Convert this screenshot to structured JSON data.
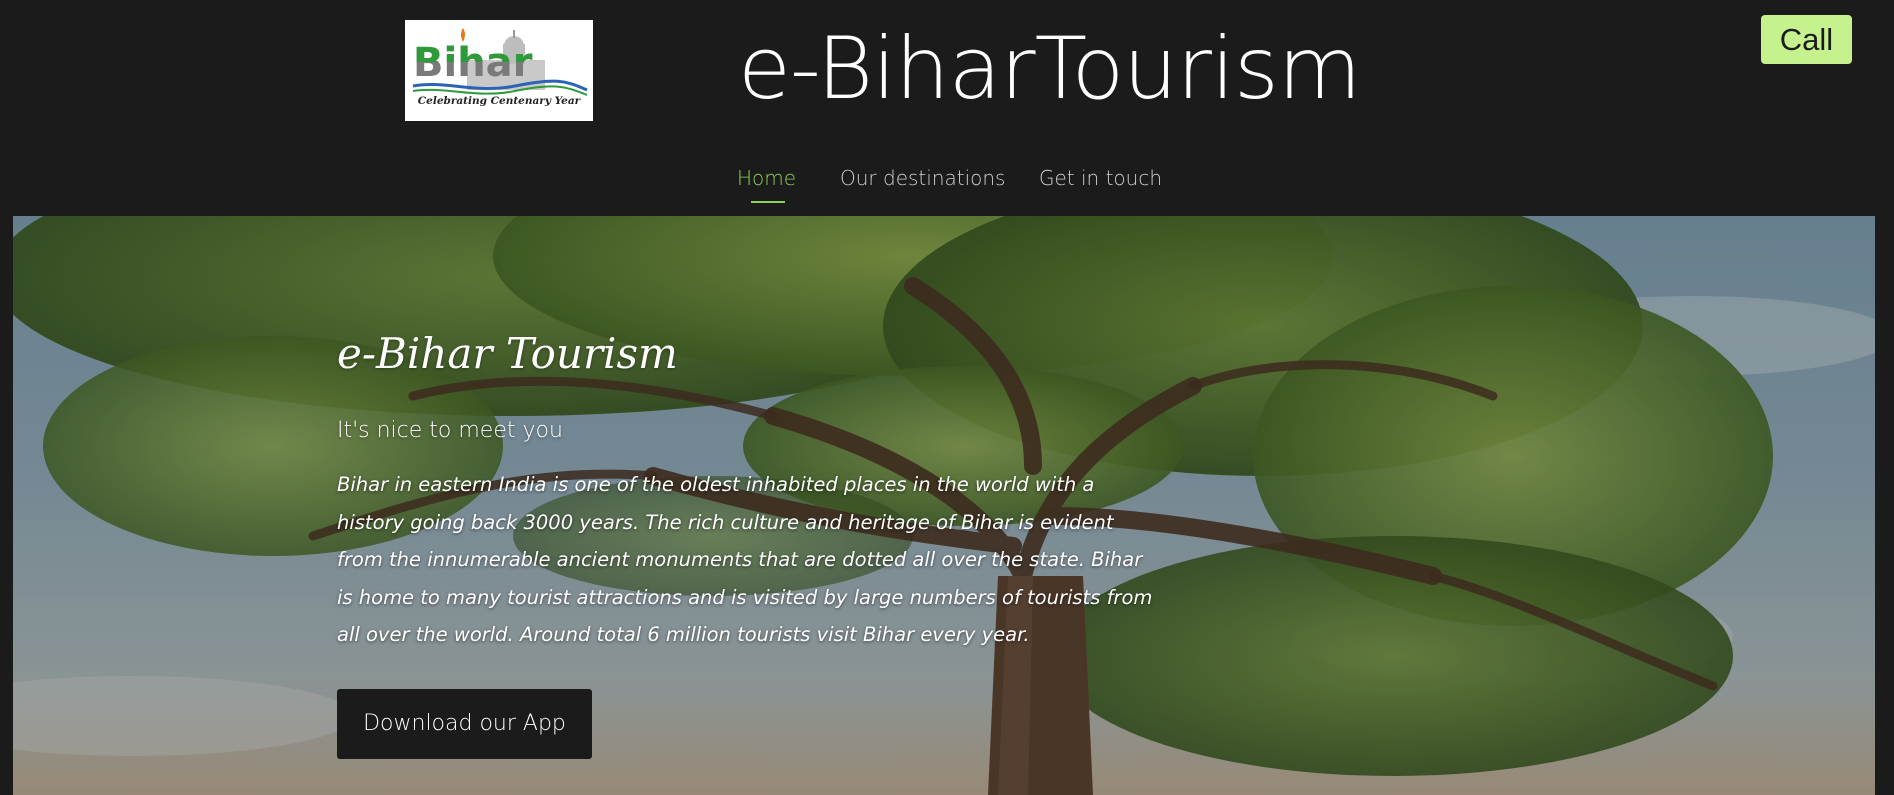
{
  "header": {
    "logo": {
      "wordmark": "Bihar",
      "tagline": "Celebrating Centenary Year"
    },
    "site_title": "e-BiharTourism",
    "call_label": "Call"
  },
  "nav": {
    "items": [
      {
        "label": "Home",
        "active": true
      },
      {
        "label": "Our destinations",
        "active": false
      },
      {
        "label": "Get in touch",
        "active": false
      }
    ],
    "active_color": "#8fcf5a",
    "inactive_color": "#cfcfcf"
  },
  "hero": {
    "heading": "e-Bihar Tourism",
    "subheading": "It's nice to meet you",
    "description": "Bihar in eastern India is one of the oldest inhabited places in the world with a history going back 3000 years. The rich culture and heritage of Bihar is evident from the innumerable ancient monuments that are dotted all over the state. Bihar is home to many tourist attractions and is visited by large numbers of tourists from all over the world. Around total 6 million tourists visit Bihar every year.",
    "button_label": "Download our App",
    "background": "tree-photo"
  },
  "colors": {
    "page_background": "#1b1b1b",
    "call_button": "#c6f28d",
    "logo_green": "#2e9a3a"
  }
}
